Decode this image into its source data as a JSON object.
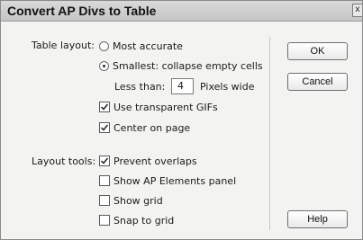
{
  "window": {
    "title": "Convert AP Divs to Table",
    "close_glyph": "x"
  },
  "table_layout": {
    "label": "Table layout:",
    "options": [
      {
        "label": "Most accurate",
        "selected": false
      },
      {
        "label": "Smallest: collapse empty cells",
        "selected": true
      }
    ],
    "less_than_label": "Less than:",
    "less_than_value": "4",
    "pixels_label": "Pixels wide",
    "checkboxes": [
      {
        "label": "Use transparent GIFs",
        "checked": true
      },
      {
        "label": "Center on page",
        "checked": true
      }
    ]
  },
  "layout_tools": {
    "label": "Layout tools:",
    "checkboxes": [
      {
        "label": "Prevent overlaps",
        "checked": true
      },
      {
        "label": "Show AP Elements panel",
        "checked": false
      },
      {
        "label": "Show grid",
        "checked": false
      },
      {
        "label": "Snap to grid",
        "checked": false
      }
    ]
  },
  "buttons": {
    "ok": "OK",
    "cancel": "Cancel",
    "help": "Help"
  }
}
